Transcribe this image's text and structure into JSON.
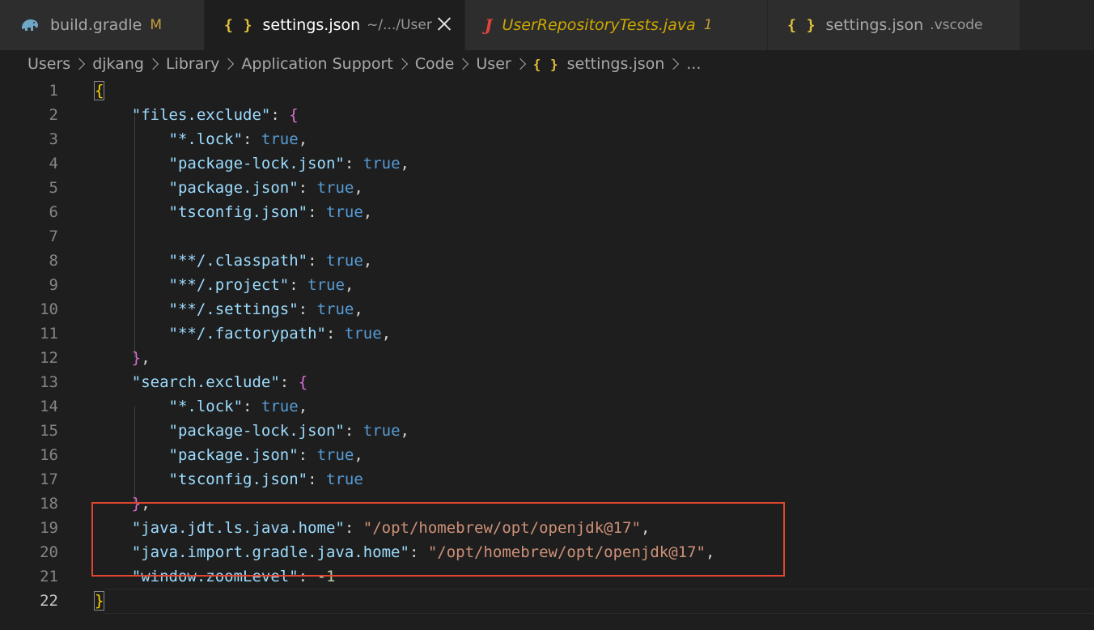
{
  "tabs": [
    {
      "label": "build.gradle",
      "badge": "M",
      "icon": "gradle-elephant-icon"
    },
    {
      "label": "settings.json",
      "desc": "~/.../User",
      "icon": "json-braces-icon",
      "active": true
    },
    {
      "label": "UserRepositoryTests.java",
      "badge": "1",
      "icon": "java-icon"
    },
    {
      "label": "settings.json",
      "desc": ".vscode",
      "icon": "json-braces-icon"
    }
  ],
  "icons": {
    "json": "{ }",
    "java": "J"
  },
  "breadcrumb": [
    "Users",
    "djkang",
    "Library",
    "Application Support",
    "Code",
    "User",
    "settings.json",
    "..."
  ],
  "colors": {
    "key": "#9cdcfe",
    "string": "#ce9178",
    "boolean": "#569cd6",
    "number": "#b5cea8",
    "bracket_outer": "#ffd700",
    "bracket_inner": "#da70d6",
    "highlight_box": "#e0462f"
  },
  "lines": [
    {
      "num": "1",
      "tokens": [
        {
          "t": "{",
          "c": "br1 hl-bracket"
        }
      ]
    },
    {
      "num": "2",
      "tokens": [
        {
          "t": "    "
        },
        {
          "t": "\"files.exclude\"",
          "c": "k"
        },
        {
          "t": ": ",
          "c": "p"
        },
        {
          "t": "{",
          "c": "br2"
        }
      ]
    },
    {
      "num": "3",
      "tokens": [
        {
          "t": "        "
        },
        {
          "t": "\"*.lock\"",
          "c": "k"
        },
        {
          "t": ": ",
          "c": "p"
        },
        {
          "t": "true",
          "c": "b"
        },
        {
          "t": ",",
          "c": "p"
        }
      ]
    },
    {
      "num": "4",
      "tokens": [
        {
          "t": "        "
        },
        {
          "t": "\"package-lock.json\"",
          "c": "k"
        },
        {
          "t": ": ",
          "c": "p"
        },
        {
          "t": "true",
          "c": "b"
        },
        {
          "t": ",",
          "c": "p"
        }
      ]
    },
    {
      "num": "5",
      "tokens": [
        {
          "t": "        "
        },
        {
          "t": "\"package.json\"",
          "c": "k"
        },
        {
          "t": ": ",
          "c": "p"
        },
        {
          "t": "true",
          "c": "b"
        },
        {
          "t": ",",
          "c": "p"
        }
      ]
    },
    {
      "num": "6",
      "tokens": [
        {
          "t": "        "
        },
        {
          "t": "\"tsconfig.json\"",
          "c": "k"
        },
        {
          "t": ": ",
          "c": "p"
        },
        {
          "t": "true",
          "c": "b"
        },
        {
          "t": ",",
          "c": "p"
        }
      ]
    },
    {
      "num": "7",
      "tokens": []
    },
    {
      "num": "8",
      "tokens": [
        {
          "t": "        "
        },
        {
          "t": "\"**/.classpath\"",
          "c": "k"
        },
        {
          "t": ": ",
          "c": "p"
        },
        {
          "t": "true",
          "c": "b"
        },
        {
          "t": ",",
          "c": "p"
        }
      ]
    },
    {
      "num": "9",
      "tokens": [
        {
          "t": "        "
        },
        {
          "t": "\"**/.project\"",
          "c": "k"
        },
        {
          "t": ": ",
          "c": "p"
        },
        {
          "t": "true",
          "c": "b"
        },
        {
          "t": ",",
          "c": "p"
        }
      ]
    },
    {
      "num": "10",
      "tokens": [
        {
          "t": "        "
        },
        {
          "t": "\"**/.settings\"",
          "c": "k"
        },
        {
          "t": ": ",
          "c": "p"
        },
        {
          "t": "true",
          "c": "b"
        },
        {
          "t": ",",
          "c": "p"
        }
      ]
    },
    {
      "num": "11",
      "tokens": [
        {
          "t": "        "
        },
        {
          "t": "\"**/.factorypath\"",
          "c": "k"
        },
        {
          "t": ": ",
          "c": "p"
        },
        {
          "t": "true",
          "c": "b"
        },
        {
          "t": ",",
          "c": "p"
        }
      ]
    },
    {
      "num": "12",
      "tokens": [
        {
          "t": "    "
        },
        {
          "t": "}",
          "c": "br2"
        },
        {
          "t": ",",
          "c": "p"
        }
      ]
    },
    {
      "num": "13",
      "tokens": [
        {
          "t": "    "
        },
        {
          "t": "\"search.exclude\"",
          "c": "k"
        },
        {
          "t": ": ",
          "c": "p"
        },
        {
          "t": "{",
          "c": "br2"
        }
      ]
    },
    {
      "num": "14",
      "tokens": [
        {
          "t": "        "
        },
        {
          "t": "\"*.lock\"",
          "c": "k"
        },
        {
          "t": ": ",
          "c": "p"
        },
        {
          "t": "true",
          "c": "b"
        },
        {
          "t": ",",
          "c": "p"
        }
      ]
    },
    {
      "num": "15",
      "tokens": [
        {
          "t": "        "
        },
        {
          "t": "\"package-lock.json\"",
          "c": "k"
        },
        {
          "t": ": ",
          "c": "p"
        },
        {
          "t": "true",
          "c": "b"
        },
        {
          "t": ",",
          "c": "p"
        }
      ]
    },
    {
      "num": "16",
      "tokens": [
        {
          "t": "        "
        },
        {
          "t": "\"package.json\"",
          "c": "k"
        },
        {
          "t": ": ",
          "c": "p"
        },
        {
          "t": "true",
          "c": "b"
        },
        {
          "t": ",",
          "c": "p"
        }
      ]
    },
    {
      "num": "17",
      "tokens": [
        {
          "t": "        "
        },
        {
          "t": "\"tsconfig.json\"",
          "c": "k"
        },
        {
          "t": ": ",
          "c": "p"
        },
        {
          "t": "true",
          "c": "b"
        }
      ]
    },
    {
      "num": "18",
      "tokens": [
        {
          "t": "    "
        },
        {
          "t": "}",
          "c": "br2"
        },
        {
          "t": ",",
          "c": "p"
        }
      ]
    },
    {
      "num": "19",
      "tokens": [
        {
          "t": "    "
        },
        {
          "t": "\"java.jdt.ls.java.home\"",
          "c": "k"
        },
        {
          "t": ": ",
          "c": "p"
        },
        {
          "t": "\"/opt/homebrew/opt/openjdk@17\"",
          "c": "s"
        },
        {
          "t": ",",
          "c": "p"
        }
      ]
    },
    {
      "num": "20",
      "tokens": [
        {
          "t": "    "
        },
        {
          "t": "\"java.import.gradle.java.home\"",
          "c": "k"
        },
        {
          "t": ": ",
          "c": "p"
        },
        {
          "t": "\"/opt/homebrew/opt/openjdk@17\"",
          "c": "s"
        },
        {
          "t": ",",
          "c": "p"
        }
      ]
    },
    {
      "num": "21",
      "tokens": [
        {
          "t": "    "
        },
        {
          "t": "\"window.zoomLevel\"",
          "c": "k"
        },
        {
          "t": ": ",
          "c": "p"
        },
        {
          "t": "-1",
          "c": "n"
        }
      ]
    },
    {
      "num": "22",
      "tokens": [
        {
          "t": "}",
          "c": "br1 hl-bracket"
        }
      ],
      "current": true
    }
  ]
}
